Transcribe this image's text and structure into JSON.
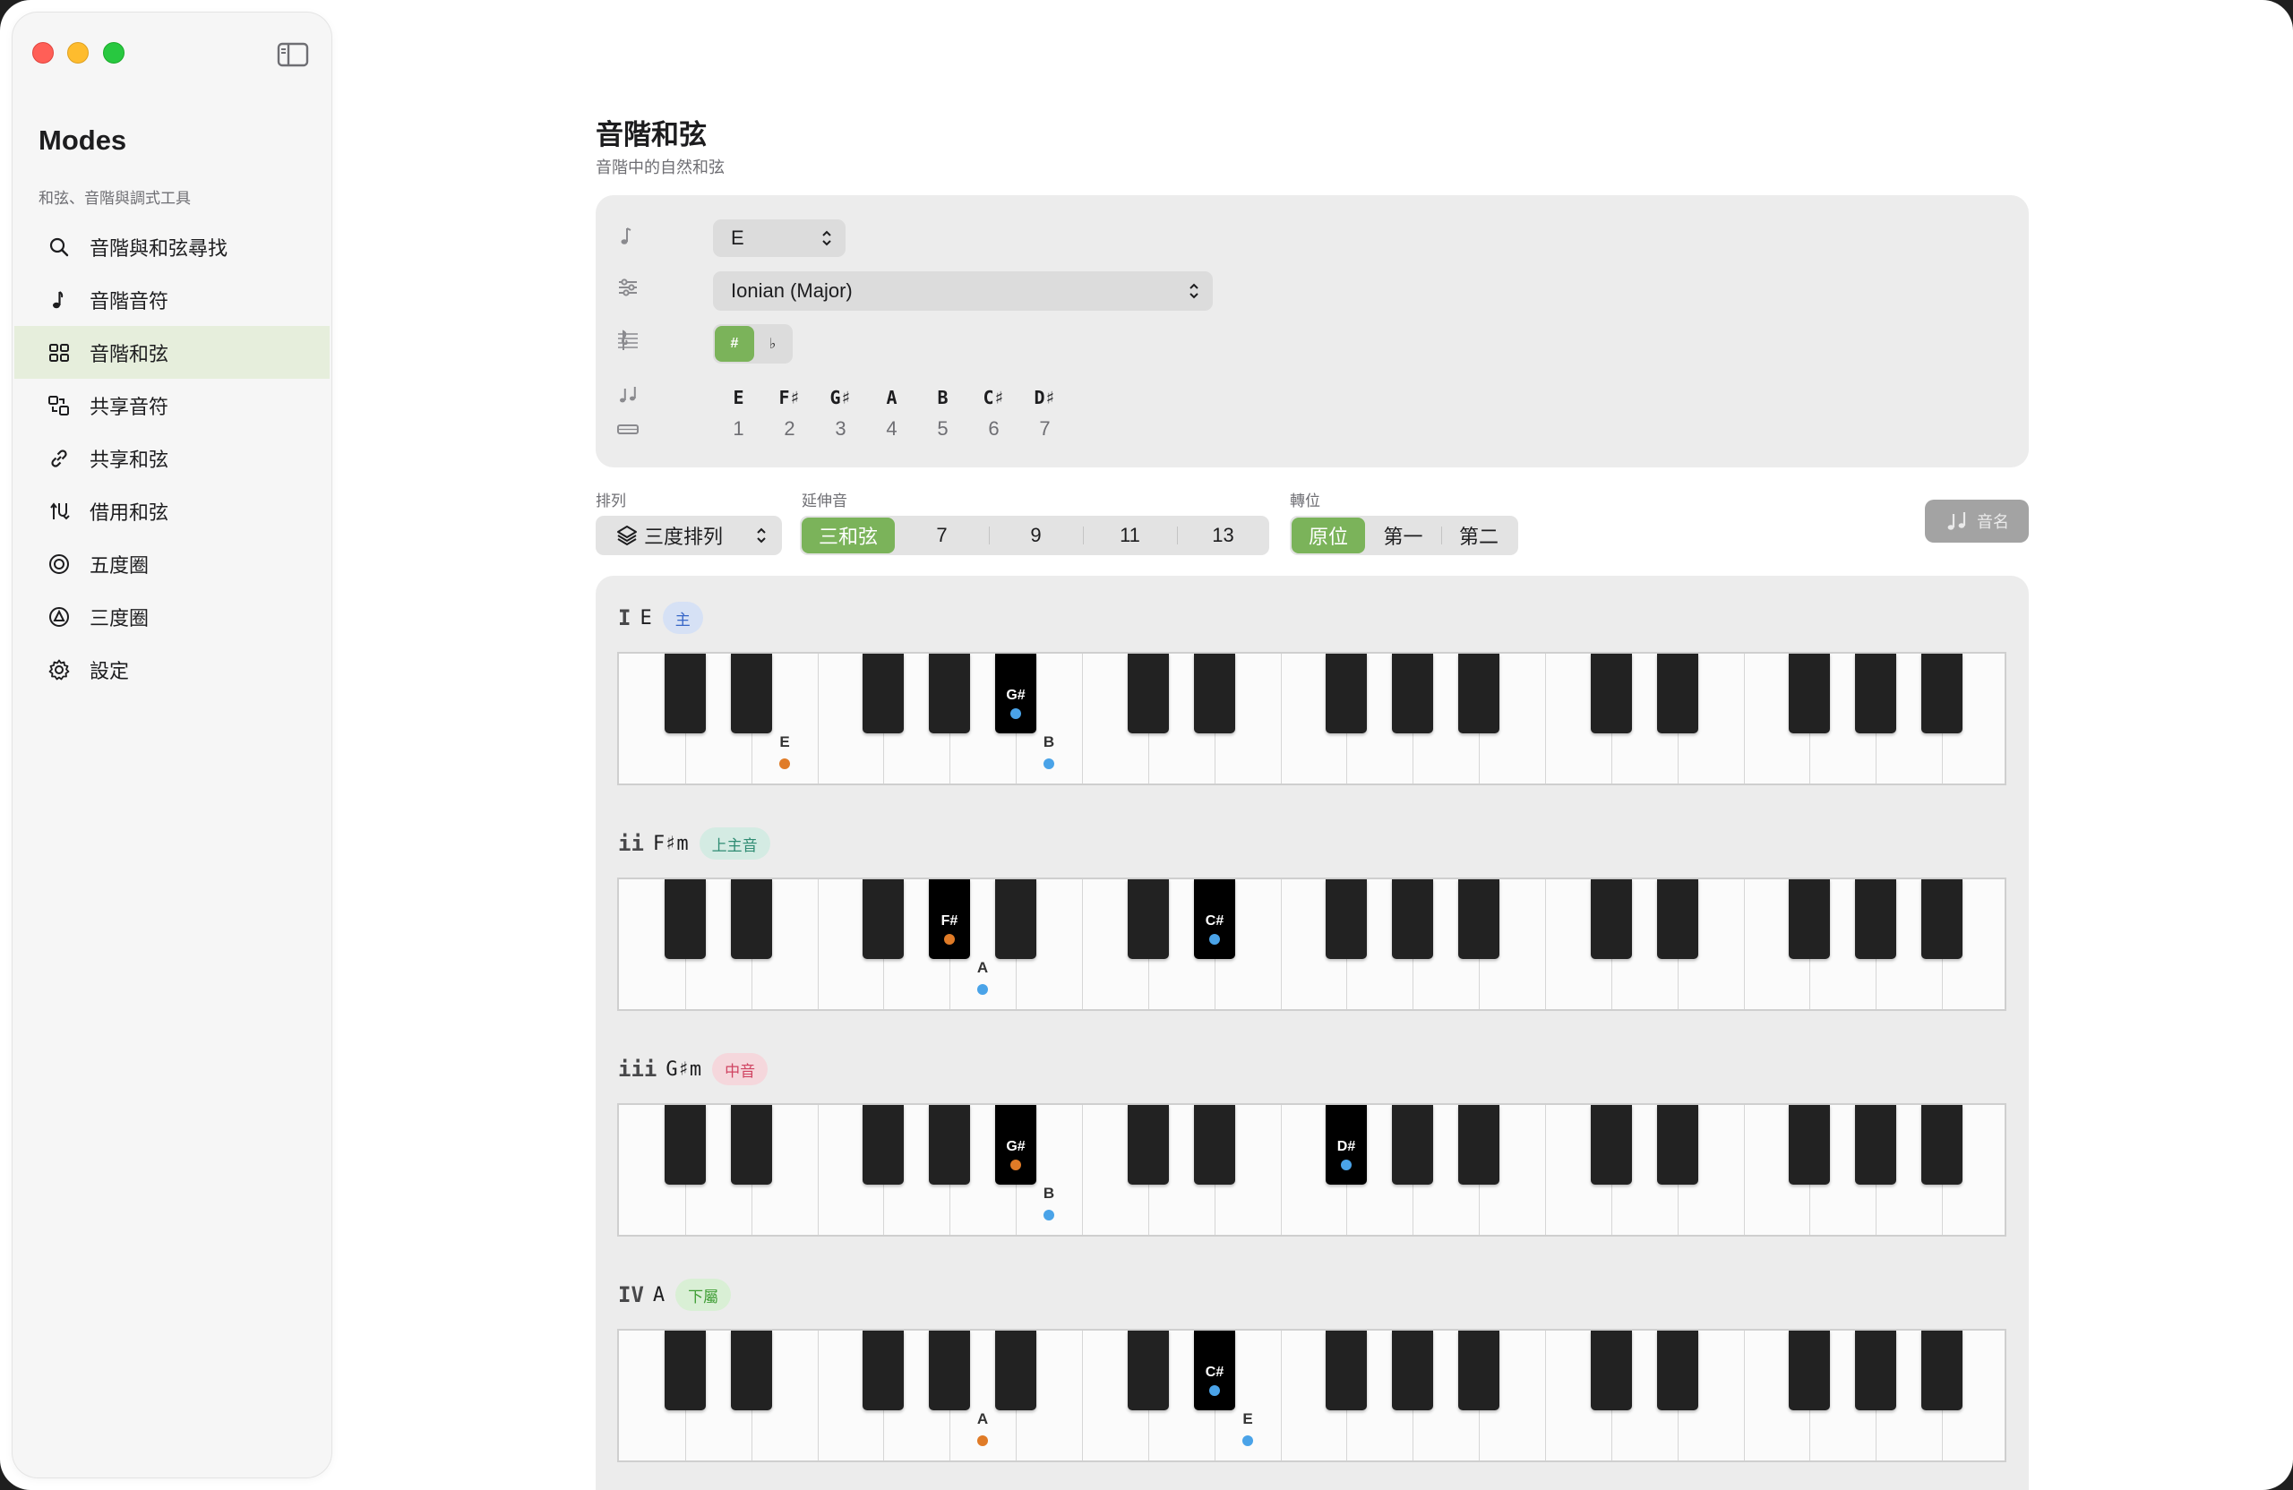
{
  "app": {
    "title": "Modes",
    "subtitle": "和弦、音階與調式工具"
  },
  "sidebar": {
    "items": [
      {
        "label": "音階與和弦尋找",
        "icon": "search-icon",
        "active": false
      },
      {
        "label": "音階音符",
        "icon": "music-note-icon",
        "active": false
      },
      {
        "label": "音階和弦",
        "icon": "grid-icon",
        "active": true
      },
      {
        "label": "共享音符",
        "icon": "shared-shapes-icon",
        "active": false
      },
      {
        "label": "共享和弦",
        "icon": "link-icon",
        "active": false
      },
      {
        "label": "借用和弦",
        "icon": "borrow-arrows-icon",
        "active": false
      },
      {
        "label": "五度圈",
        "icon": "circle-target-icon",
        "active": false
      },
      {
        "label": "三度圈",
        "icon": "triangle-circle-icon",
        "active": false
      },
      {
        "label": "設定",
        "icon": "gear-icon",
        "active": false
      }
    ]
  },
  "page": {
    "title": "音階和弦",
    "subtitle": "音階中的自然和弦"
  },
  "controls": {
    "key": "E",
    "mode": "Ionian (Major)",
    "accidentals": {
      "sharp": "#",
      "flat": "♭",
      "selected": "sharp"
    },
    "scale_notes": [
      "E",
      "F♯",
      "G♯",
      "A",
      "B",
      "C♯",
      "D♯"
    ],
    "scale_degrees": [
      "1",
      "2",
      "3",
      "4",
      "5",
      "6",
      "7"
    ]
  },
  "options": {
    "arrangement_label": "排列",
    "arrangement_value": "三度排列",
    "extension_label": "延伸音",
    "extensions": [
      "三和弦",
      "7",
      "9",
      "11",
      "13"
    ],
    "extension_selected": "三和弦",
    "inversion_label": "轉位",
    "inversions": [
      "原位",
      "第一",
      "第二"
    ],
    "inversion_selected": "原位",
    "note_name_button": "音名"
  },
  "colors": {
    "accent": "#7bb35a",
    "root_dot": "#e07b27",
    "tone_dot": "#4aa3e8"
  },
  "chords": [
    {
      "roman": "I",
      "name": "E",
      "function": "主",
      "badge_color": "blue",
      "notes": [
        {
          "label": "E",
          "key": "w2",
          "role": "root"
        },
        {
          "label": "G#",
          "key": "b4",
          "role": "tone"
        },
        {
          "label": "B",
          "key": "w6",
          "role": "tone"
        }
      ]
    },
    {
      "roman": "ii",
      "name": "F♯m",
      "function": "上主音",
      "badge_color": "teal",
      "notes": [
        {
          "label": "F#",
          "key": "b3",
          "role": "root"
        },
        {
          "label": "A",
          "key": "w5",
          "role": "tone"
        },
        {
          "label": "C#",
          "key": "b6",
          "role": "tone"
        }
      ]
    },
    {
      "roman": "iii",
      "name": "G♯m",
      "function": "中音",
      "badge_color": "pink",
      "notes": [
        {
          "label": "G#",
          "key": "b4",
          "role": "root"
        },
        {
          "label": "B",
          "key": "w6",
          "role": "tone"
        },
        {
          "label": "D#",
          "key": "b7",
          "role": "tone"
        }
      ]
    },
    {
      "roman": "IV",
      "name": "A",
      "function": "下屬",
      "badge_color": "green",
      "notes": [
        {
          "label": "A",
          "key": "w5",
          "role": "root"
        },
        {
          "label": "C#",
          "key": "b6",
          "role": "tone"
        },
        {
          "label": "E",
          "key": "w9",
          "role": "tone"
        }
      ]
    }
  ]
}
